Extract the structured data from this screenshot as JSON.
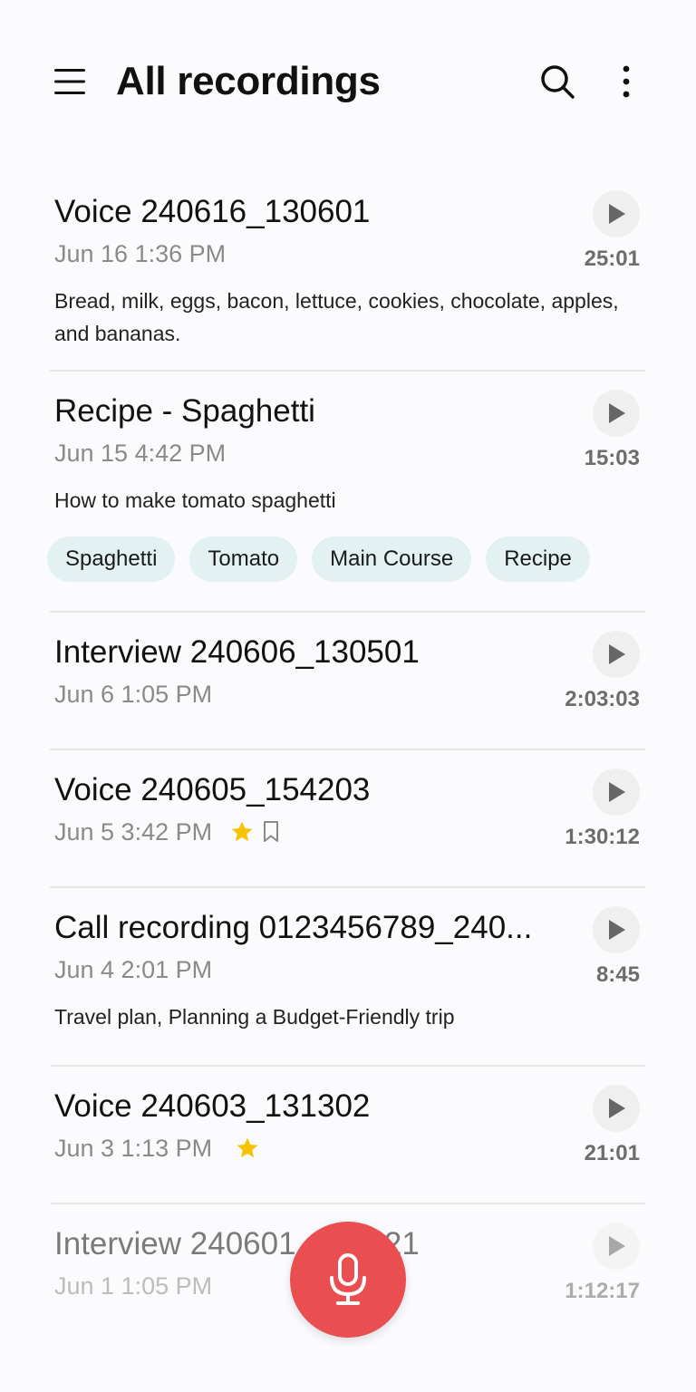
{
  "header": {
    "title": "All recordings",
    "menu_icon": "hamburger-menu-icon",
    "search_icon": "search-icon",
    "more_icon": "more-vertical-icon"
  },
  "recordings": [
    {
      "title": "Voice 240616_130601",
      "date": "Jun 16 1:36 PM",
      "duration": "25:01",
      "description": "Bread, milk, eggs, bacon, lettuce, cookies, chocolate, apples, and bananas."
    },
    {
      "title": "Recipe - Spaghetti",
      "date": "Jun 15 4:42 PM",
      "duration": "15:03",
      "description": "How to make tomato spaghetti",
      "tags": [
        "Spaghetti",
        "Tomato",
        "Main Course",
        "Recipe"
      ]
    },
    {
      "title": "Interview 240606_130501",
      "date": "Jun 6 1:05 PM",
      "duration": "2:03:03"
    },
    {
      "title": "Voice 240605_154203",
      "date": "Jun 5 3:42 PM",
      "duration": "1:30:12",
      "starred": true,
      "bookmarked": true
    },
    {
      "title": "Call recording 0123456789_240...",
      "date": "Jun 4 2:01 PM",
      "duration": "8:45",
      "description": "Travel plan, Planning a Budget-Friendly trip"
    },
    {
      "title": "Voice 240603_131302",
      "date": "Jun 3 1:13 PM",
      "duration": "21:01",
      "starred": true
    },
    {
      "title": "Interview 240601_130521",
      "date": "Jun 1 1:05 PM",
      "duration": "1:12:17"
    }
  ],
  "colors": {
    "accent": "#e94e50",
    "star": "#f7c300",
    "tag_bg": "#e3f1f3"
  },
  "fab": {
    "icon": "microphone-icon"
  }
}
